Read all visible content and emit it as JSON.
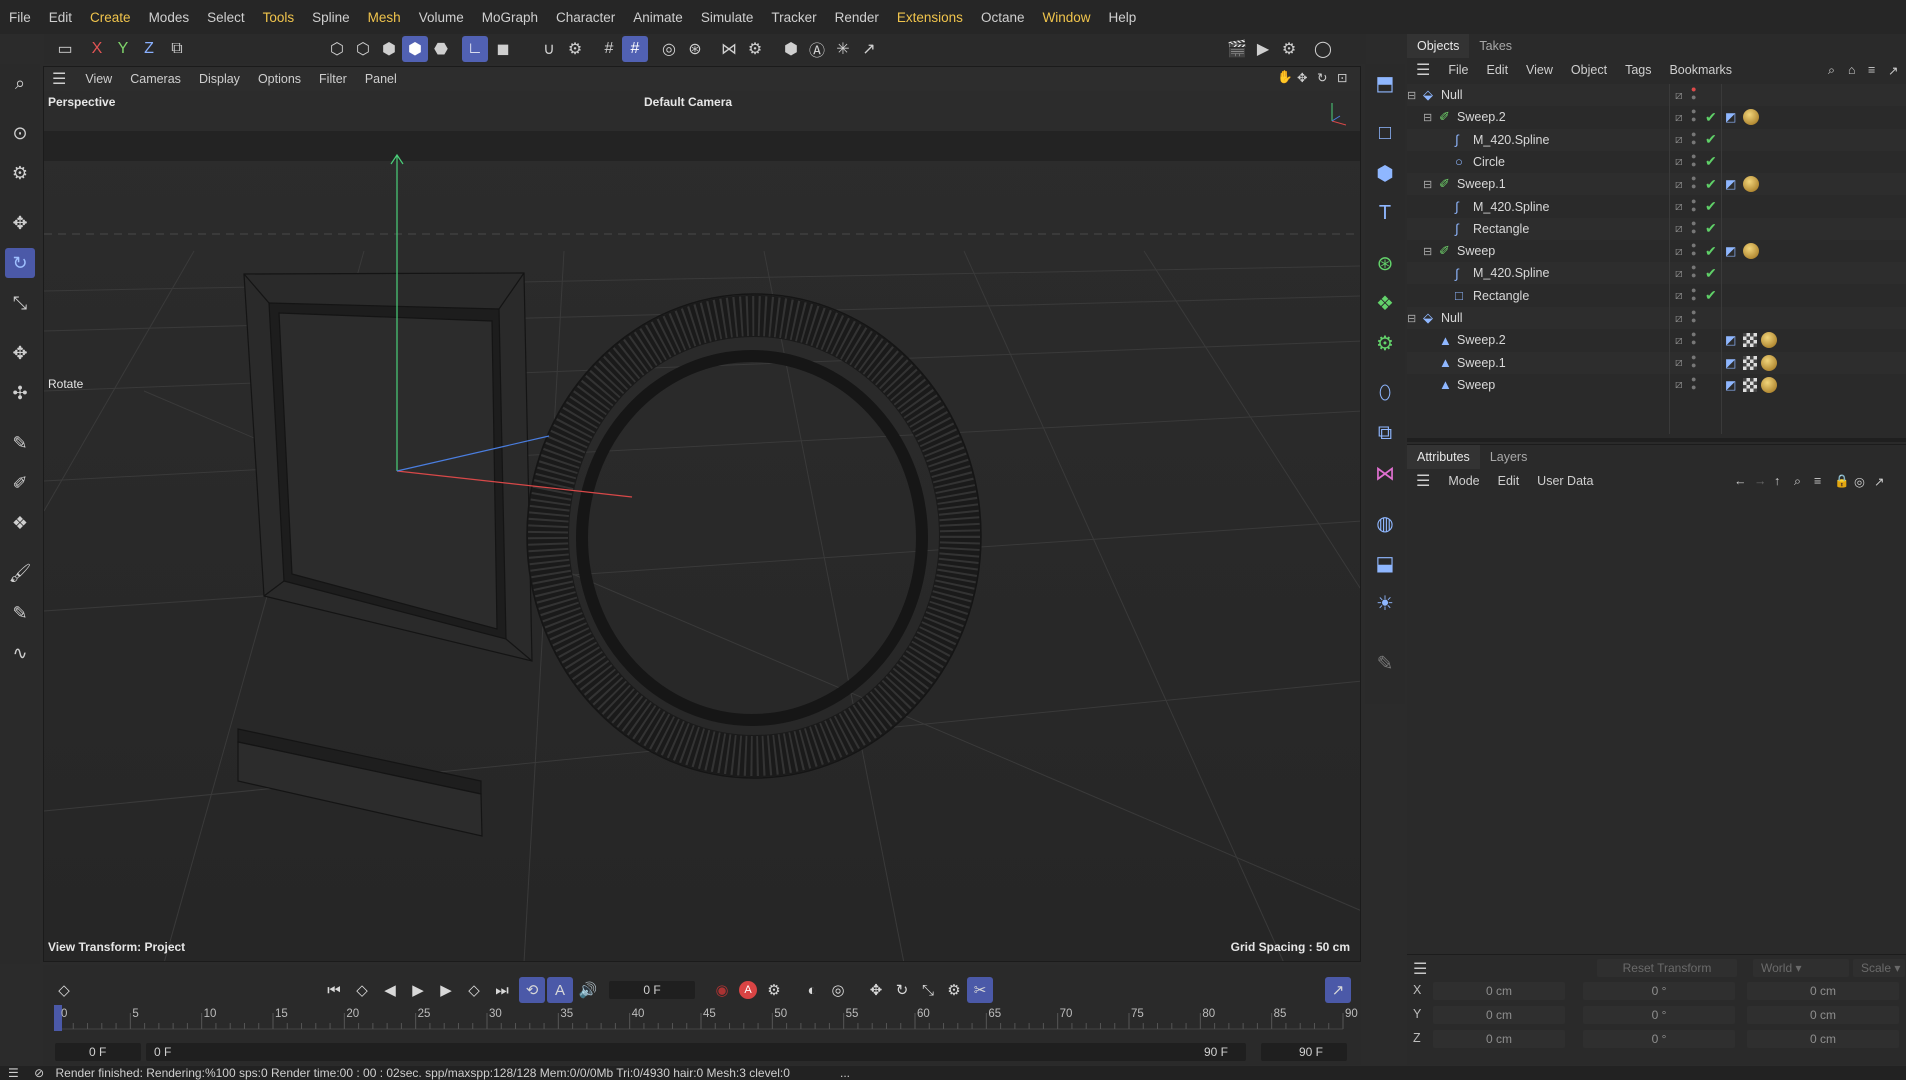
{
  "menubar": {
    "items": [
      {
        "label": "File"
      },
      {
        "label": "Edit"
      },
      {
        "label": "Create"
      },
      {
        "label": "Modes"
      },
      {
        "label": "Select"
      },
      {
        "label": "Tools"
      },
      {
        "label": "Spline"
      },
      {
        "label": "Mesh"
      },
      {
        "label": "Volume"
      },
      {
        "label": "MoGraph"
      },
      {
        "label": "Character"
      },
      {
        "label": "Animate"
      },
      {
        "label": "Simulate"
      },
      {
        "label": "Tracker"
      },
      {
        "label": "Render"
      },
      {
        "label": "Extensions"
      },
      {
        "label": "Octane"
      },
      {
        "label": "Window"
      },
      {
        "label": "Help"
      }
    ]
  },
  "toolbar": {
    "axis_x": "X",
    "axis_y": "Y",
    "axis_z": "Z"
  },
  "viewport": {
    "menu": [
      "View",
      "Cameras",
      "Display",
      "Options",
      "Filter",
      "Panel"
    ],
    "projection": "Perspective",
    "camera": "Default Camera",
    "tool": "Rotate",
    "view_transform": "View Transform: Project",
    "grid_spacing": "Grid Spacing : 50 cm"
  },
  "objects_panel": {
    "tabs": [
      "Objects",
      "Takes"
    ],
    "menu": [
      "File",
      "Edit",
      "View",
      "Object",
      "Tags",
      "Bookmarks"
    ],
    "tree": [
      {
        "name": "Null",
        "icon": "null-icon",
        "expand": "⊟",
        "level": 0
      },
      {
        "name": "Sweep.2",
        "icon": "sweep-icon",
        "expand": "⊟",
        "level": 1
      },
      {
        "name": "M_420.Spline",
        "icon": "spline-icon",
        "level": 2
      },
      {
        "name": "Circle",
        "icon": "circle-icon",
        "level": 2
      },
      {
        "name": "Sweep.1",
        "icon": "sweep-icon",
        "expand": "⊟",
        "level": 1
      },
      {
        "name": "M_420.Spline",
        "icon": "spline-icon",
        "level": 2
      },
      {
        "name": "Rectangle",
        "icon": "spline-icon",
        "level": 2
      },
      {
        "name": "Sweep",
        "icon": "sweep-icon",
        "expand": "⊟",
        "level": 1
      },
      {
        "name": "M_420.Spline",
        "icon": "spline-icon",
        "level": 2
      },
      {
        "name": "Rectangle",
        "icon": "rectangle-icon",
        "level": 2
      },
      {
        "name": "Null",
        "icon": "null-icon",
        "expand": "⊟",
        "level": 0
      },
      {
        "name": "Sweep.2",
        "icon": "polygon-object-icon",
        "level": 1
      },
      {
        "name": "Sweep.1",
        "icon": "polygon-object-icon",
        "level": 1
      },
      {
        "name": "Sweep",
        "icon": "polygon-object-icon",
        "level": 1
      }
    ]
  },
  "attributes_panel": {
    "tabs": [
      "Attributes",
      "Layers"
    ],
    "menu": [
      "Mode",
      "Edit",
      "User Data"
    ]
  },
  "coordinates": {
    "reset_label": "Reset Transform",
    "space": "World",
    "mode": "Scale",
    "rows": [
      {
        "axis": "X",
        "pos": "0 cm",
        "rot": "0 °",
        "size": "0 cm"
      },
      {
        "axis": "Y",
        "pos": "0 cm",
        "rot": "0 °",
        "size": "0 cm"
      },
      {
        "axis": "Z",
        "pos": "0 cm",
        "rot": "0 °",
        "size": "0 cm"
      }
    ]
  },
  "timeline": {
    "current_frame": "0 F",
    "ruler": [
      "0",
      "5",
      "10",
      "15",
      "20",
      "25",
      "30",
      "35",
      "40",
      "45",
      "50",
      "55",
      "60",
      "65",
      "70",
      "75",
      "80",
      "85",
      "90"
    ],
    "start_field": "0 F",
    "preview_start": "0 F",
    "preview_end": "90 F",
    "end_field": "90 F"
  },
  "status": {
    "text": "Render finished: Rendering:%100 sps:0 Render time:00 : 00 : 02sec. spp/maxspp:128/128 Mem:0/0/0Mb Tri:0/4930 hair:0 Mesh:3 clevel:0",
    "ellipsis": "..."
  },
  "colors": {
    "accent": "#5161b3",
    "highlight": "#f0c44c",
    "check": "#5fd068"
  }
}
